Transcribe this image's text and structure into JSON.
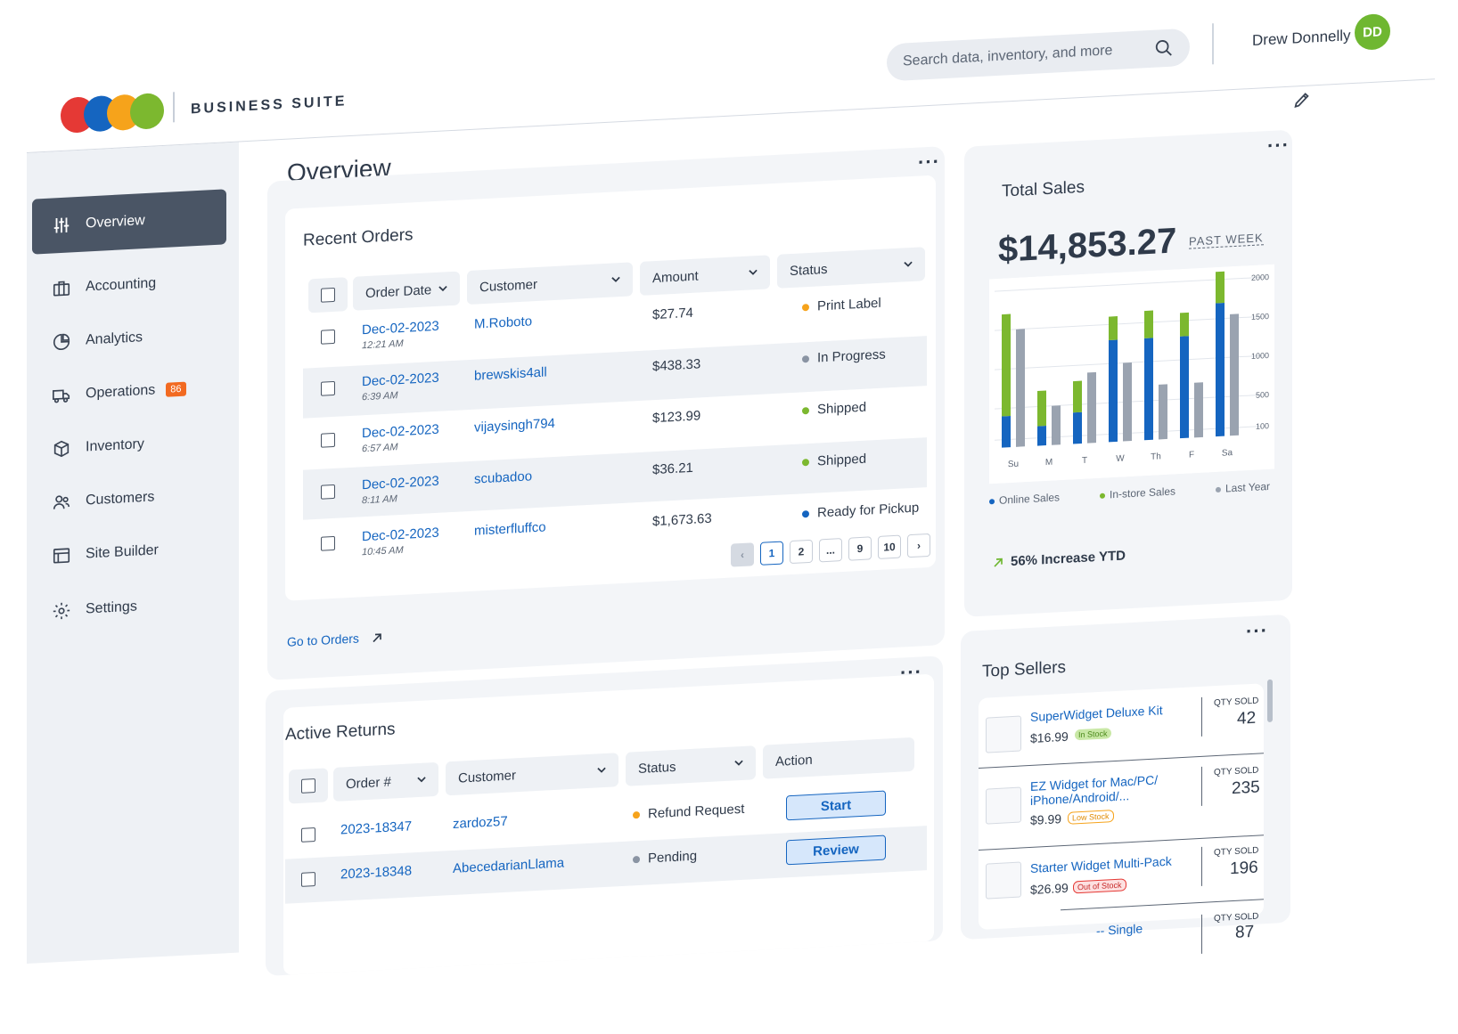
{
  "header": {
    "search_placeholder": "Search data, inventory, and more",
    "user_name": "Drew Donnelly",
    "user_initials": "DD",
    "brand": "BUSINESS SUITE"
  },
  "sidebar": {
    "items": [
      {
        "label": "Overview"
      },
      {
        "label": "Accounting"
      },
      {
        "label": "Analytics"
      },
      {
        "label": "Operations",
        "badge": "86"
      },
      {
        "label": "Inventory"
      },
      {
        "label": "Customers"
      },
      {
        "label": "Site Builder"
      },
      {
        "label": "Settings"
      }
    ]
  },
  "main": {
    "title": "Overview",
    "recent_orders": {
      "title": "Recent Orders",
      "columns": [
        "Order Date",
        "Customer",
        "Amount",
        "Status"
      ],
      "rows": [
        {
          "date": "Dec-02-2023",
          "time": "12:21 AM",
          "customer": "M.Roboto",
          "amount": "$27.74",
          "status": "Print Label"
        },
        {
          "date": "Dec-02-2023",
          "time": "6:39 AM",
          "customer": "brewskis4all",
          "amount": "$438.33",
          "status": "In Progress"
        },
        {
          "date": "Dec-02-2023",
          "time": "6:57 AM",
          "customer": "vijaysingh794",
          "amount": "$123.99",
          "status": "Shipped"
        },
        {
          "date": "Dec-02-2023",
          "time": "8:11 AM",
          "customer": "scubadoo",
          "amount": "$36.21",
          "status": "Shipped"
        },
        {
          "date": "Dec-02-2023",
          "time": "10:45 AM",
          "customer": "misterfluffco",
          "amount": "$1,673.63",
          "status": "Ready for Pickup"
        }
      ],
      "pages": [
        "1",
        "2",
        "...",
        "9",
        "10"
      ],
      "go_link": "Go to Orders"
    },
    "active_returns": {
      "title": "Active Returns",
      "columns": [
        "Order #",
        "Customer",
        "Status",
        "Action"
      ],
      "rows": [
        {
          "order": "2023-18347",
          "customer": "zardoz57",
          "status": "Refund Request",
          "action": "Start"
        },
        {
          "order": "2023-18348",
          "customer": "AbecedarianLlama",
          "status": "Pending",
          "action": "Review"
        }
      ]
    }
  },
  "total_sales": {
    "title": "Total Sales",
    "amount": "$14,853.27",
    "period": "PAST WEEK",
    "ytd": "56% Increase YTD",
    "legend": [
      "Online Sales",
      "In-store Sales",
      "Last Year"
    ]
  },
  "chart_data": {
    "type": "bar",
    "categories": [
      "Su",
      "M",
      "T",
      "W",
      "Th",
      "F",
      "Sa"
    ],
    "y_ticks": [
      "2000",
      "1500",
      "1000",
      "500",
      "100"
    ],
    "ylim": [
      0,
      2000
    ],
    "series": [
      {
        "name": "Online Sales",
        "values": [
          400,
          250,
          400,
          1300,
          1300,
          1300,
          1700
        ]
      },
      {
        "name": "In-store Sales",
        "values": [
          1300,
          450,
          400,
          300,
          350,
          300,
          400
        ]
      },
      {
        "name": "Last Year",
        "values": [
          1500,
          500,
          900,
          1000,
          700,
          700,
          1550
        ]
      }
    ],
    "colors": {
      "Online Sales": "#1565c0",
      "In-store Sales": "#7cb82f",
      "Last Year": "#9aa3b0"
    }
  },
  "top_sellers": {
    "title": "Top Sellers",
    "qty_label": "QTY SOLD",
    "items": [
      {
        "name": "SuperWidget Deluxe Kit",
        "price": "$16.99",
        "stock": "In Stock",
        "qty": "42"
      },
      {
        "name": "EZ Widget for Mac/PC/ iPhone/Android/...",
        "price": "$9.99",
        "stock": "Low Stock",
        "qty": "235"
      },
      {
        "name": "Starter Widget Multi-Pack",
        "price": "$26.99",
        "stock": "Out of Stock",
        "qty": "196"
      },
      {
        "name": "-- Single",
        "price": "",
        "stock": "",
        "qty": "87"
      }
    ]
  },
  "colors": {
    "accent": "#1565c0",
    "badge": "#f26a21",
    "avatar": "#6fb731",
    "active_nav": "#4a5565"
  }
}
